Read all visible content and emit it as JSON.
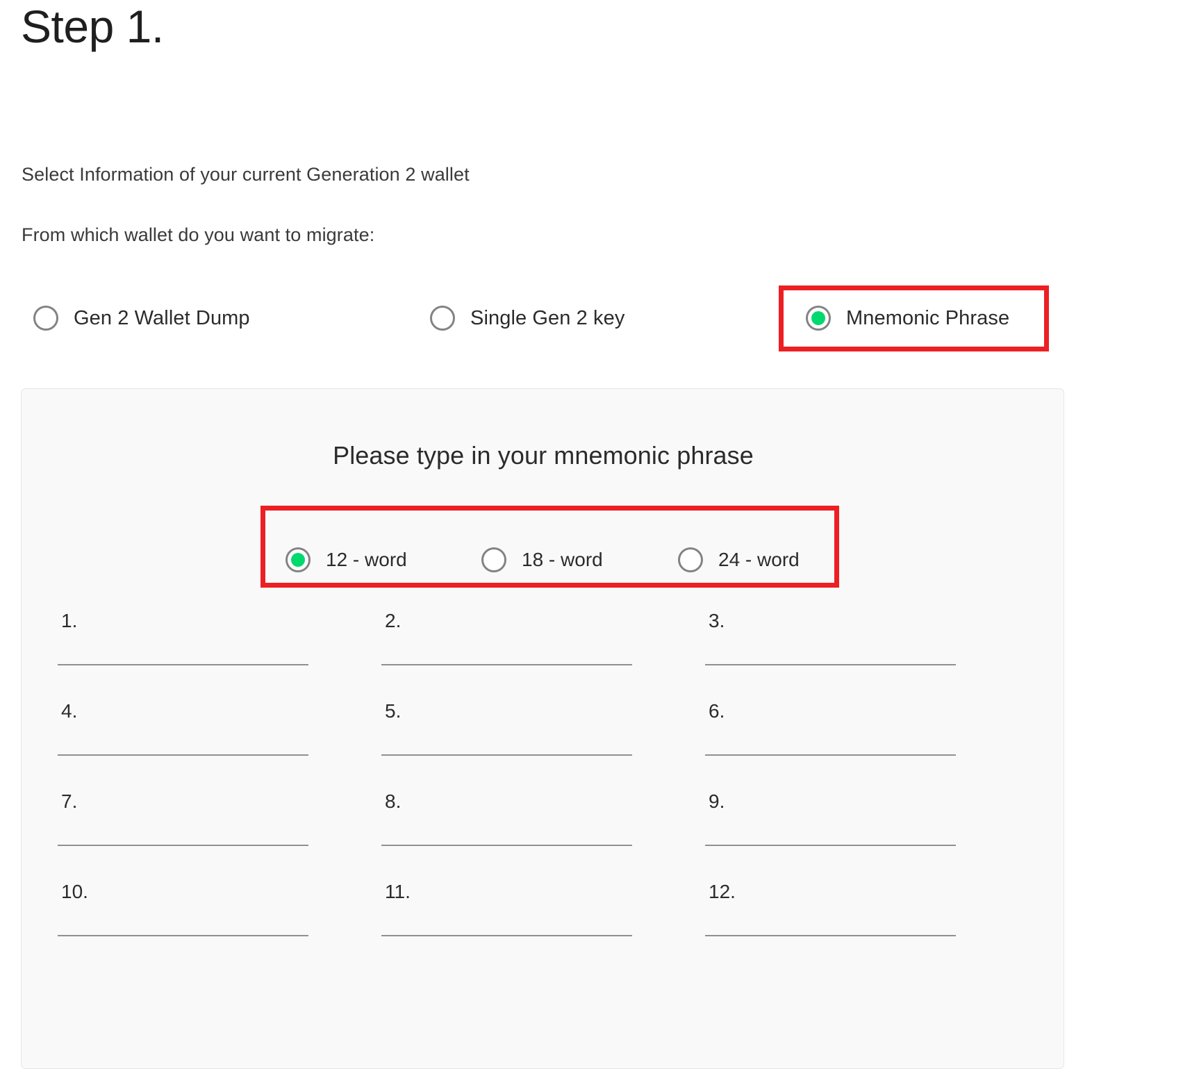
{
  "page": {
    "title": "Step 1.",
    "intro_line_1": "Select Information of your current Generation 2 wallet",
    "intro_line_2": "From which wallet do you want to migrate:"
  },
  "colors": {
    "accent_green": "#00d96e",
    "annotation_red": "#ec2024",
    "radio_ring_gray": "#838383",
    "panel_background": "#f9f9f9",
    "input_underline": "#909090"
  },
  "source_selection": {
    "selected": "Mnemonic Phrase",
    "options": [
      {
        "label": "Gen 2 Wallet Dump",
        "checked": false,
        "highlighted": false
      },
      {
        "label": "Single Gen 2 key",
        "checked": false,
        "highlighted": false
      },
      {
        "label": "Mnemonic Phrase",
        "checked": true,
        "highlighted": true
      }
    ]
  },
  "mnemonic_panel": {
    "title": "Please type in your mnemonic phrase",
    "word_count_selected": "12 - word",
    "word_count_options": [
      {
        "label": "12 - word",
        "checked": true
      },
      {
        "label": "18 - word",
        "checked": false
      },
      {
        "label": "24 - word",
        "checked": false
      }
    ],
    "word_fields": [
      {
        "number": "1.",
        "value": "",
        "placeholder": ""
      },
      {
        "number": "2.",
        "value": "",
        "placeholder": ""
      },
      {
        "number": "3.",
        "value": "",
        "placeholder": ""
      },
      {
        "number": "4.",
        "value": "",
        "placeholder": ""
      },
      {
        "number": "5.",
        "value": "",
        "placeholder": ""
      },
      {
        "number": "6.",
        "value": "",
        "placeholder": ""
      },
      {
        "number": "7.",
        "value": "",
        "placeholder": ""
      },
      {
        "number": "8.",
        "value": "",
        "placeholder": ""
      },
      {
        "number": "9.",
        "value": "",
        "placeholder": ""
      },
      {
        "number": "10.",
        "value": "",
        "placeholder": ""
      },
      {
        "number": "11.",
        "value": "",
        "placeholder": ""
      },
      {
        "number": "12.",
        "value": "",
        "placeholder": ""
      }
    ]
  }
}
